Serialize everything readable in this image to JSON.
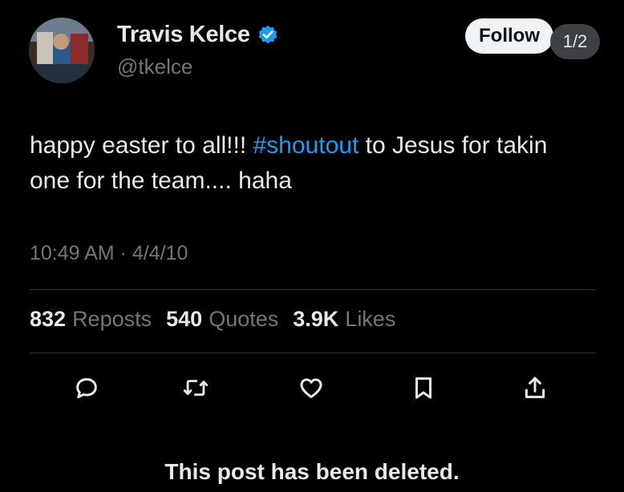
{
  "author": {
    "display_name": "Travis Kelce",
    "handle": "@tkelce",
    "verified": true
  },
  "header": {
    "follow_label": "Follow",
    "page_indicator": "1/2"
  },
  "tweet": {
    "text_part1": "happy easter to all!!! ",
    "hashtag": "#shoutout",
    "text_part2": " to Jesus for takin one for the team.... haha",
    "timestamp": "10:49 AM · 4/4/10"
  },
  "stats": {
    "reposts_count": "832",
    "reposts_label": "Reposts",
    "quotes_count": "540",
    "quotes_label": "Quotes",
    "likes_count": "3.9K",
    "likes_label": "Likes"
  },
  "actions": [
    "reply-icon",
    "repost-icon",
    "like-icon",
    "bookmark-icon",
    "share-icon"
  ],
  "notice": {
    "deleted_text": "This post has been deleted."
  },
  "colors": {
    "background": "#000000",
    "text": "#e7e9ea",
    "secondary_text": "#71767b",
    "link": "#1d9bf0",
    "verified_badge": "#1d9bf0"
  }
}
